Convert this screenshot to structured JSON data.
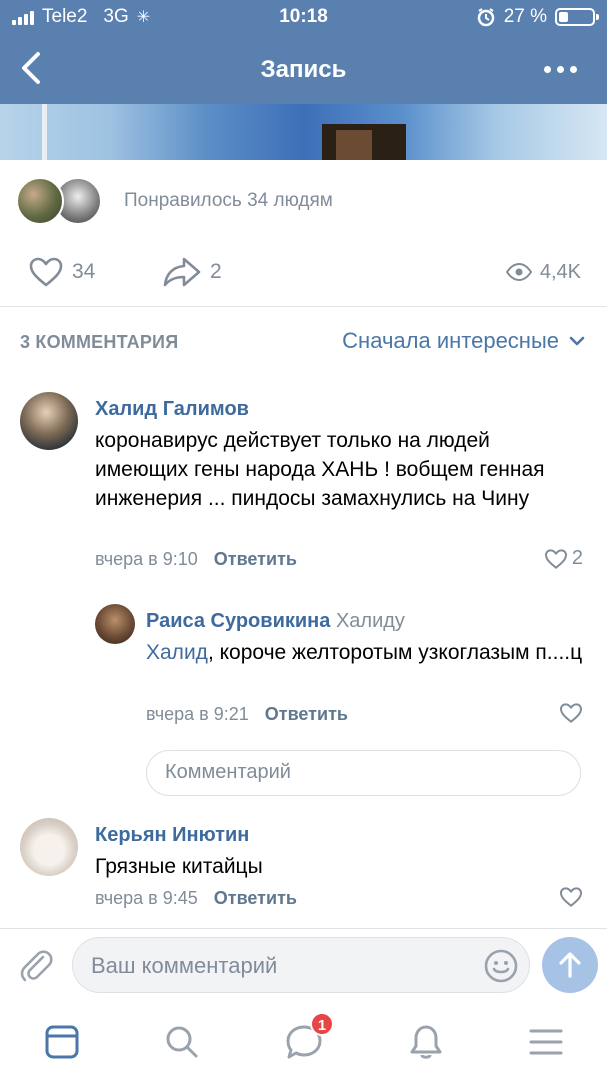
{
  "status_bar": {
    "carrier": "Tele2",
    "network": "3G",
    "time": "10:18",
    "battery": "27 %",
    "battery_level": 0.27
  },
  "nav": {
    "title": "Запись",
    "back_icon": "chevron-left-icon",
    "more_icon": "more-horizontal-icon"
  },
  "likes_summary": {
    "text": "Понравилось 34 людям"
  },
  "actions": {
    "likes": "34",
    "shares": "2",
    "views": "4,4K"
  },
  "comments_header": {
    "count_label": "3 КОММЕНТАРИЯ",
    "sort_label": "Сначала интересные"
  },
  "comments": [
    {
      "author": "Халид Галимов",
      "text": "коронавирус действует только на людей имеющих гены народа ХАНЬ ! вобщем генная инженерия ... пиндосы замахнулись на Чину",
      "time": "вчера в 9:10",
      "reply_label": "Ответить",
      "likes": "2"
    },
    {
      "author": "Раиса Суровикина",
      "reply_to": "Халиду",
      "mention": "Халид",
      "text": ", короче желторотым узкоглазым п....ц",
      "time": "вчера в 9:21",
      "reply_label": "Ответить",
      "likes": ""
    },
    {
      "author": "Керьян Инютин",
      "text": "Грязные китайцы",
      "time": "вчера в 9:45",
      "reply_label": "Ответить",
      "likes": ""
    }
  ],
  "thread_reply": {
    "placeholder": "Комментарий"
  },
  "comment_input": {
    "placeholder": "Ваш комментарий",
    "value": ""
  },
  "tabbar": {
    "items": [
      "news-icon",
      "search-icon",
      "messages-icon",
      "notifications-icon",
      "menu-icon"
    ],
    "messages_badge": "1"
  },
  "colors": {
    "header": "#5a80b0",
    "link": "#3f6a9e",
    "accent": "#4a76a8",
    "muted": "#818c99",
    "badge": "#e64646"
  }
}
